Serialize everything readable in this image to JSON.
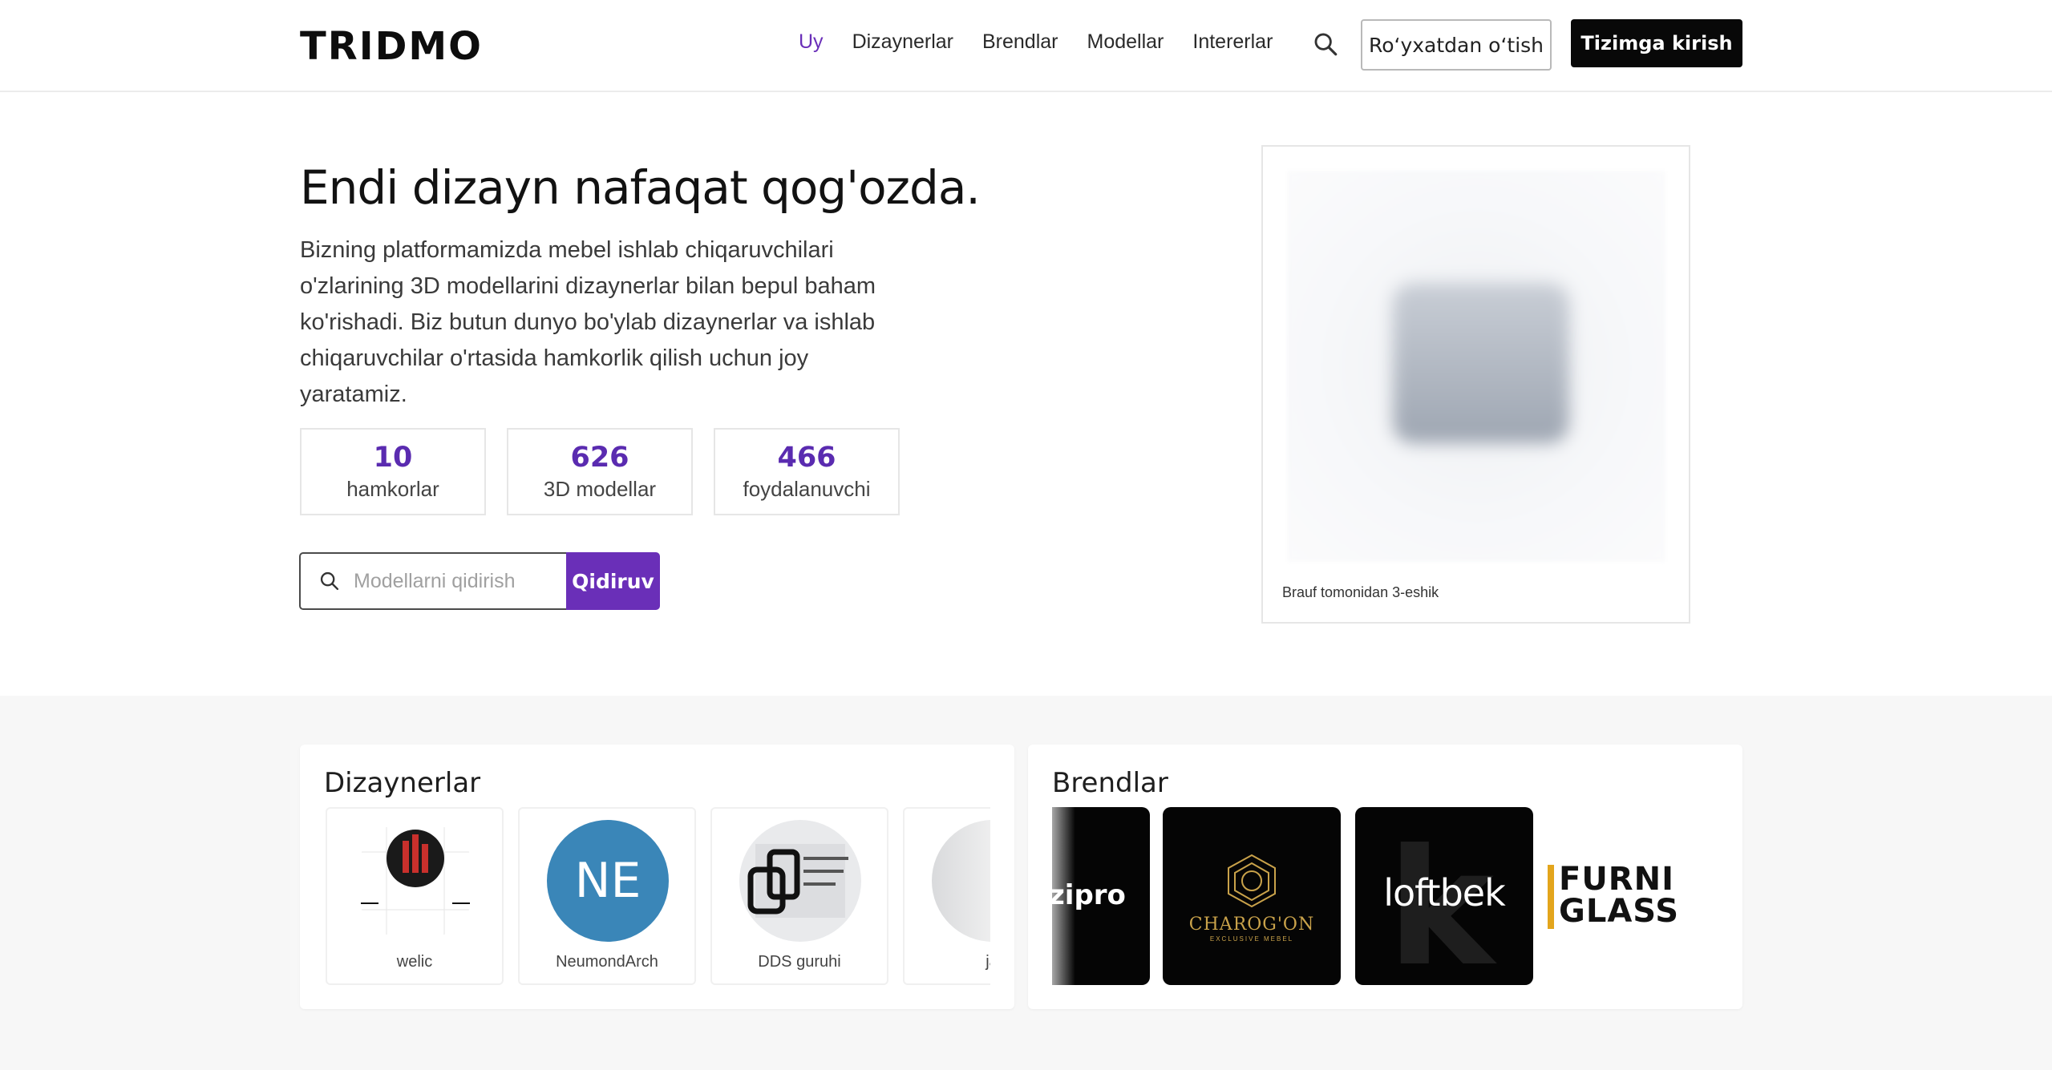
{
  "header": {
    "logo": "TRIDMO",
    "nav": [
      "Uy",
      "Dizaynerlar",
      "Brendlar",
      "Modellar",
      "Intererlar"
    ],
    "register_label": "Ro‘yxatdan o‘tish",
    "login_label": "Tizimga kirish"
  },
  "hero": {
    "title": "Endi dizayn nafaqat qog'ozda.",
    "text": "Bizning platformamizda mebel ishlab chiqaruvchilari o'zlarining 3D modellarini dizaynerlar bilan bepul baham ko'rishadi. Biz butun dunyo bo'ylab dizaynerlar va ishlab chiqaruvchilar o'rtasida hamkorlik qilish uchun joy yaratamiz.",
    "stats": [
      {
        "value": "10",
        "label": "hamkorlar"
      },
      {
        "value": "626",
        "label": "3D modellar"
      },
      {
        "value": "466",
        "label": "foydalanuvchi"
      }
    ],
    "search_placeholder": "Modellarni qidirish",
    "search_button": "Qidiruv",
    "preview_caption": "Brauf tomonidan 3-eshik"
  },
  "designers": {
    "title": "Dizaynerlar",
    "items": [
      {
        "name": "welic"
      },
      {
        "name": "NeumondArch",
        "initials": "NE"
      },
      {
        "name": "DDS guruhi"
      },
      {
        "name": "ja"
      }
    ]
  },
  "brands": {
    "title": "Brendlar",
    "items": [
      {
        "name": "zipro"
      },
      {
        "name": "CHAROG'ON",
        "sub": "EXCLUSIVE MEBEL"
      },
      {
        "name": "loftbek"
      },
      {
        "name": "FURNI GLASS"
      }
    ]
  },
  "colors": {
    "accent": "#6a2fb8",
    "dark": "#080808",
    "avatar_blue": "#3a86b8",
    "gold": "#c9a24a"
  }
}
